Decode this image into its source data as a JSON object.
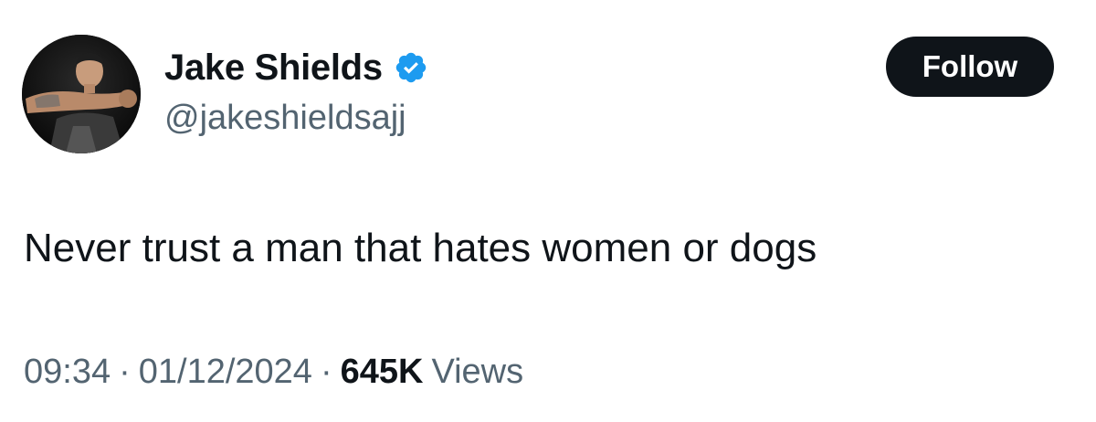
{
  "author": {
    "display_name": "Jake Shields",
    "handle": "@jakeshieldsajj",
    "verified": true,
    "verified_color": "#1d9bf0",
    "avatar_icon": "profile-photo"
  },
  "follow_button": {
    "label": "Follow",
    "background": "#0f1419",
    "text_color": "#ffffff"
  },
  "tweet": {
    "text": "Never trust a man that hates women or dogs",
    "time": "09:34",
    "separator": "·",
    "date": "01/12/2024",
    "views_count": "645K",
    "views_label": "Views"
  }
}
